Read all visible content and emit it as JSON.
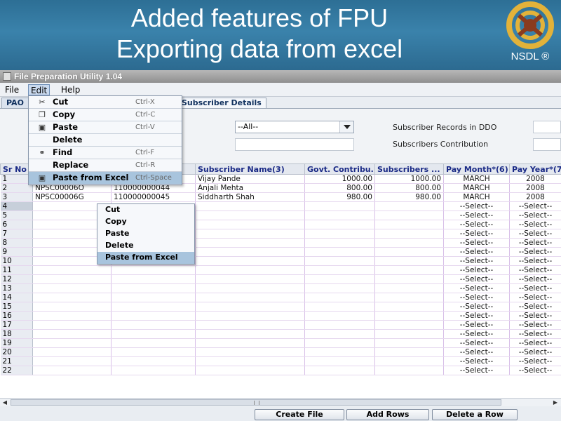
{
  "slide": {
    "title_line1": "Added features of FPU",
    "title_line2": "Exporting data from excel",
    "logo_text": "NSDL ®",
    "header_color": "#3a82ab"
  },
  "app": {
    "title": "File Preparation Utility 1.04",
    "menus": [
      "File",
      "Edit",
      "Help"
    ],
    "tabs": [
      "PAO",
      "Subscriber Details"
    ]
  },
  "panel": {
    "ddo_combo_value": "--All--",
    "label_records": "Subscriber Records in DDO",
    "label_contribution": "Subscribers Contribution"
  },
  "edit_menu": [
    {
      "label": "Cut",
      "shortcut": "Ctrl-X",
      "icon": "scissors-icon"
    },
    {
      "label": "Copy",
      "shortcut": "Ctrl-C",
      "icon": "copy-icon"
    },
    {
      "label": "Paste",
      "shortcut": "Ctrl-V",
      "icon": "paste-icon"
    },
    {
      "label": "Delete",
      "shortcut": "",
      "icon": ""
    },
    {
      "label": "Find",
      "shortcut": "Ctrl-F",
      "icon": "binoculars-icon"
    },
    {
      "label": "Replace",
      "shortcut": "Ctrl-R",
      "icon": ""
    },
    {
      "label": "Paste from Excel",
      "shortcut": "Ctrl-Space",
      "icon": "paste-excel-icon"
    }
  ],
  "context_menu": [
    "Cut",
    "Copy",
    "Paste",
    "Delete",
    "Paste from Excel"
  ],
  "table": {
    "columns": [
      "Sr No",
      "",
      "",
      "Subscriber Name(3)",
      "Govt. Contribu...",
      "Subscribers ...",
      "Pay Month*(6)",
      "Pay Year*(7)"
    ],
    "rows": [
      {
        "sr": "1",
        "pran": "",
        "acc": "",
        "name": "Vijay Pande",
        "govt": "1000.00",
        "subs": "1000.00",
        "month": "MARCH",
        "year": "2008"
      },
      {
        "sr": "2",
        "pran": "NPSC00006O",
        "acc": "110000000044",
        "name": "Anjali Mehta",
        "govt": "800.00",
        "subs": "800.00",
        "month": "MARCH",
        "year": "2008"
      },
      {
        "sr": "3",
        "pran": "NPSC00006G",
        "acc": "110000000045",
        "name": "Siddharth Shah",
        "govt": "980.00",
        "subs": "980.00",
        "month": "MARCH",
        "year": "2008"
      }
    ],
    "empty_rows_from": 4,
    "empty_rows_to": 22,
    "select_placeholder": "--Select--"
  },
  "buttons": [
    "Create File",
    "Add Rows",
    "Delete a Row"
  ]
}
